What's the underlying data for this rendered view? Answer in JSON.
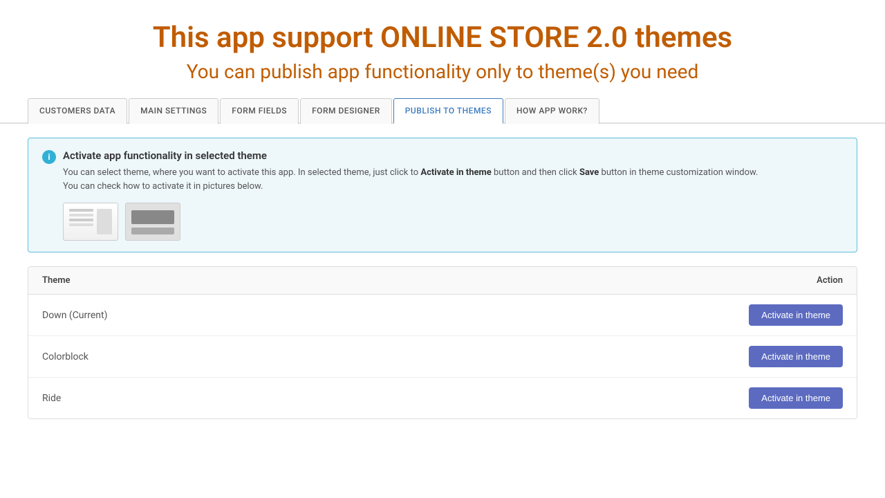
{
  "header": {
    "title": "This app support ONLINE STORE 2.0 themes",
    "subtitle": "You can publish app functionality only to theme(s) you need"
  },
  "tabs": [
    {
      "id": "customers-data",
      "label": "CUSTOMERS DATA",
      "active": false
    },
    {
      "id": "main-settings",
      "label": "MAIN SETTINGS",
      "active": false
    },
    {
      "id": "form-fields",
      "label": "FORM FIELDS",
      "active": false
    },
    {
      "id": "form-designer",
      "label": "FORM DESIGNER",
      "active": false
    },
    {
      "id": "publish-to-themes",
      "label": "PUBLISH TO THEMES",
      "active": true
    },
    {
      "id": "how-app-work",
      "label": "HOW APP WORK?",
      "active": false
    }
  ],
  "info_box": {
    "title": "Activate app functionality in selected theme",
    "text_before": "You can select theme, where you want to activate this app. In selected theme, just click to ",
    "text_bold1": "Activate in theme",
    "text_middle": " button and then click ",
    "text_bold2": "Save",
    "text_after": " button in theme customization window.",
    "text_line2": "You can check how to activate it in pictures below."
  },
  "table": {
    "header": {
      "theme_label": "Theme",
      "action_label": "Action"
    },
    "rows": [
      {
        "name": "Down (Current)",
        "button_label": "Activate in theme"
      },
      {
        "name": "Colorblock",
        "button_label": "Activate in theme"
      },
      {
        "name": "Ride",
        "button_label": "Activate in theme"
      }
    ]
  },
  "colors": {
    "accent_orange": "#c05c00",
    "tab_active": "#3b7bbf",
    "button_bg": "#5c6bc0",
    "info_border": "#5bc0de",
    "info_bg": "#eef7fa"
  }
}
